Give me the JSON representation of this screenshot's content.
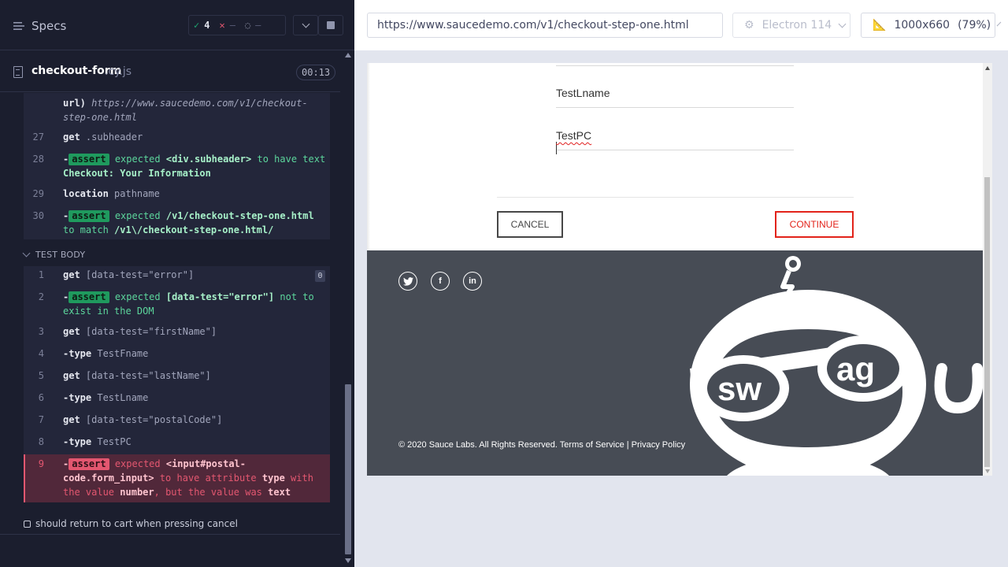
{
  "reporter": {
    "specs_label": "Specs",
    "stats": {
      "passed": "4",
      "failed": "–",
      "pending": "–"
    },
    "file": {
      "name": "checkout-form",
      "ext": ".cy.js",
      "time": "00:13"
    },
    "before_commands": [
      {
        "num": "",
        "name": "url)",
        "arg": "https://www.saucedemo.com/v1/checkout-step-one.html"
      },
      {
        "num": "27",
        "name": "get",
        "arg": ".subheader"
      },
      {
        "num": "28",
        "prefix": "-",
        "badge": "assert",
        "text1": "expected",
        "bold1": "<div.subheader>",
        "text2": "to have text",
        "bold2": "Checkout: Your Information"
      },
      {
        "num": "29",
        "name": "location",
        "arg": "pathname"
      },
      {
        "num": "30",
        "prefix": "-",
        "badge": "assert",
        "text1": "expected",
        "bold1": "/v1/checkout-step-one.html",
        "text2": "to match",
        "bold2": "/v1\\/checkout-step-one.html/"
      }
    ],
    "test_body_label": "TEST BODY",
    "test_body": [
      {
        "num": "1",
        "name": "get",
        "arg": "[data-test=\"error\"]",
        "count": "0"
      },
      {
        "num": "2",
        "prefix": "-",
        "badge": "assert",
        "text1": "expected",
        "bold1": "[data-test=\"error\"]",
        "text2": "not to exist in the DOM"
      },
      {
        "num": "3",
        "name": "get",
        "arg": "[data-test=\"firstName\"]"
      },
      {
        "num": "4",
        "name": "-type",
        "arg": "TestFname"
      },
      {
        "num": "5",
        "name": "get",
        "arg": "[data-test=\"lastName\"]"
      },
      {
        "num": "6",
        "name": "-type",
        "arg": "TestLname"
      },
      {
        "num": "7",
        "name": "get",
        "arg": "[data-test=\"postalCode\"]"
      },
      {
        "num": "8",
        "name": "-type",
        "arg": "TestPC"
      }
    ],
    "failed_command": {
      "num": "9",
      "prefix": "-",
      "badge": "assert",
      "text1": "expected",
      "bold1": "<input#postal-code.form_input>",
      "text2": "to have attribute",
      "bold2": "type",
      "text3": "with the value",
      "bold3": "number",
      "text4": ", but the value was",
      "bold4": "text"
    },
    "next_test": "should return to cart when pressing cancel"
  },
  "aut": {
    "url": "https://www.saucedemo.com/v1/checkout-step-one.html",
    "browser": "Electron 114",
    "viewport": "1000x660",
    "zoom": "(79%)",
    "form": {
      "last_name": "TestLname",
      "postal_code": "TestPC"
    },
    "cancel_label": "CANCEL",
    "continue_label": "CONTINUE",
    "footer": {
      "copyright": "© 2020 Sauce Labs. All Rights Reserved. Terms of Service | Privacy Policy",
      "social": [
        "twitter-icon",
        "facebook-icon",
        "linkedin-icon"
      ]
    },
    "colors": {
      "accent_red": "#e2231a",
      "footer_bg": "#474c55",
      "pass_green": "#1fa971",
      "fail_red": "#e45770"
    }
  }
}
